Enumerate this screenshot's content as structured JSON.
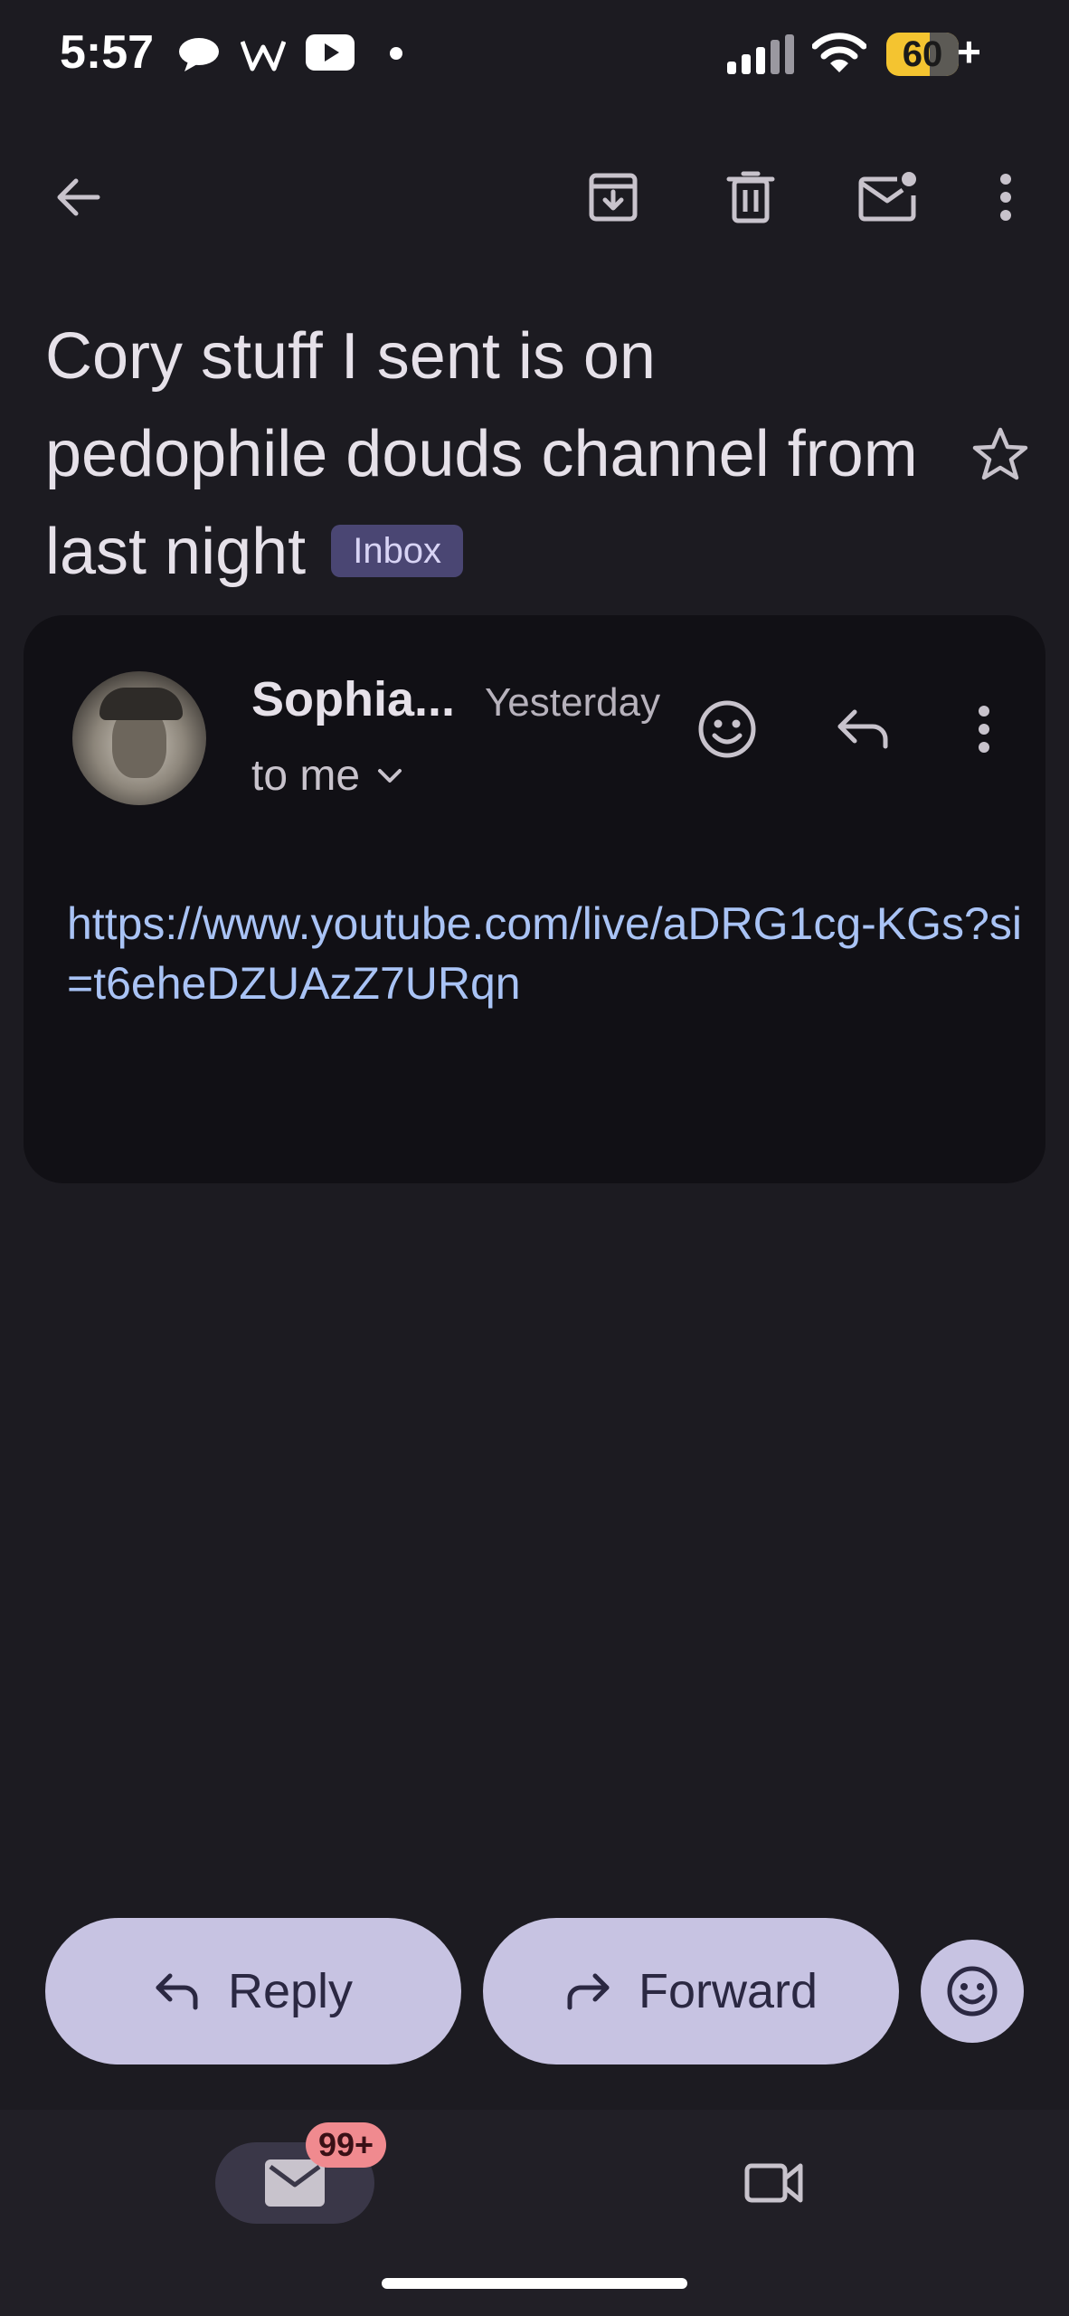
{
  "status_bar": {
    "time": "5:57",
    "battery_level": "60",
    "battery_suffix": "+",
    "icons": [
      "chat-bubble-icon",
      "wikipedia-w-icon",
      "youtube-icon",
      "notification-dot-icon",
      "cellular-signal-icon",
      "wifi-icon",
      "battery-icon"
    ]
  },
  "toolbar": {
    "back_icon": "arrow-left-icon",
    "actions": [
      "archive-icon",
      "delete-icon",
      "mark-unread-icon",
      "more-vertical-icon"
    ]
  },
  "email": {
    "subject": "Cory stuff I sent is on pedophile douds channel from last night",
    "label": "Inbox",
    "starred": false
  },
  "message": {
    "sender": "Sophia...",
    "date": "Yesterday",
    "recipient": "to me",
    "body_link": "https://www.youtube.com/live/aDRG1cg-KGs?si=t6eheDZUAzZ7URqn"
  },
  "actions": {
    "reply_label": "Reply",
    "forward_label": "Forward"
  },
  "bottom_nav": {
    "mail_badge": "99+"
  },
  "colors": {
    "background": "#1c1b21",
    "card": "#111015",
    "link": "#a9c3f5",
    "button": "#c7c3e2",
    "badge": "#f08a8f",
    "label_bg": "#4a4673",
    "battery": "#f4c430"
  }
}
